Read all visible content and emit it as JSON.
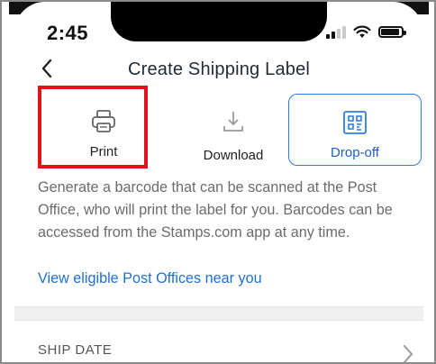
{
  "status_bar": {
    "time": "2:45"
  },
  "header": {
    "title": "Create Shipping Label",
    "back_icon": "chevron-left-icon"
  },
  "options": [
    {
      "label": "Print",
      "icon": "printer-icon"
    },
    {
      "label": "Download",
      "icon": "download-icon"
    },
    {
      "label": "Drop-off",
      "icon": "barcode-icon",
      "selected": true
    }
  ],
  "description": "Generate a barcode that can be scanned at the Post Office, who will print the label for you. Barcodes can be accessed from the Stamps.com app at any time.",
  "link_text": "View eligible Post Offices near you",
  "section": {
    "label": "SHIP DATE"
  },
  "colors": {
    "accent": "#2f7de1",
    "highlight": "#e1141c",
    "link": "#1f6fd6",
    "body_text": "#6b6b6b"
  }
}
